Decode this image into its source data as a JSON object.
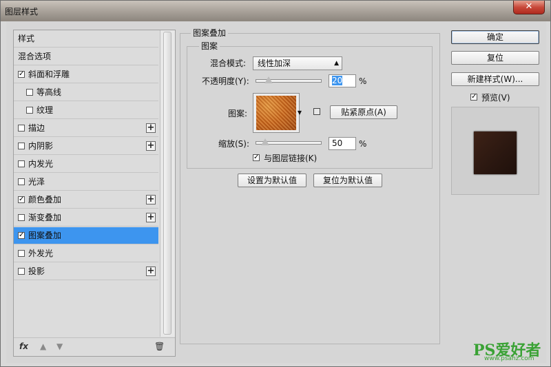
{
  "window": {
    "title": "图层样式",
    "close_glyph": "✕"
  },
  "style_list": {
    "items": [
      {
        "label": "样式",
        "checkbox": false,
        "checked": false,
        "indent": false,
        "plus": false,
        "selected": false
      },
      {
        "label": "混合选项",
        "checkbox": false,
        "checked": false,
        "indent": false,
        "plus": false,
        "selected": false
      },
      {
        "label": "斜面和浮雕",
        "checkbox": true,
        "checked": true,
        "indent": false,
        "plus": false,
        "selected": false
      },
      {
        "label": "等高线",
        "checkbox": true,
        "checked": false,
        "indent": true,
        "plus": false,
        "selected": false
      },
      {
        "label": "纹理",
        "checkbox": true,
        "checked": false,
        "indent": true,
        "plus": false,
        "selected": false
      },
      {
        "label": "描边",
        "checkbox": true,
        "checked": false,
        "indent": false,
        "plus": true,
        "selected": false
      },
      {
        "label": "内阴影",
        "checkbox": true,
        "checked": false,
        "indent": false,
        "plus": true,
        "selected": false
      },
      {
        "label": "内发光",
        "checkbox": true,
        "checked": false,
        "indent": false,
        "plus": false,
        "selected": false
      },
      {
        "label": "光泽",
        "checkbox": true,
        "checked": false,
        "indent": false,
        "plus": false,
        "selected": false
      },
      {
        "label": "颜色叠加",
        "checkbox": true,
        "checked": true,
        "indent": false,
        "plus": true,
        "selected": false
      },
      {
        "label": "渐变叠加",
        "checkbox": true,
        "checked": false,
        "indent": false,
        "plus": true,
        "selected": false
      },
      {
        "label": "图案叠加",
        "checkbox": true,
        "checked": true,
        "indent": false,
        "plus": false,
        "selected": true
      },
      {
        "label": "外发光",
        "checkbox": true,
        "checked": false,
        "indent": false,
        "plus": false,
        "selected": false
      },
      {
        "label": "投影",
        "checkbox": true,
        "checked": false,
        "indent": false,
        "plus": true,
        "selected": false
      }
    ],
    "plus_glyph": "+",
    "check_glyph": "✓",
    "bottom": {
      "fx": "fx",
      "up": "▲",
      "down": "▼",
      "trash": "🗑"
    }
  },
  "pattern_overlay": {
    "group_title": "图案叠加",
    "subgroup_title": "图案",
    "blend_mode_label": "混合模式:",
    "blend_mode_value": "线性加深",
    "opacity_label": "不透明度(Y):",
    "opacity_value": "20",
    "opacity_fraction": 0.2,
    "percent": "%",
    "pattern_label": "图案:",
    "snap_button": "贴紧原点(A)",
    "scale_label": "缩放(S):",
    "scale_value": "50",
    "scale_fraction": 0.5,
    "link_label": "与图层链接(K)",
    "link_checked": true,
    "make_default": "设置为默认值",
    "reset_default": "复位为默认值"
  },
  "right_panel": {
    "ok": "确定",
    "reset": "复位",
    "new_style": "新建样式(W)...",
    "preview_label": "预览(V)",
    "preview_checked": true
  },
  "watermark": {
    "main": "PS爱好者",
    "sub": "www.psahz.com"
  },
  "colors": {
    "selection": "#3d95ef",
    "panel": "#d6d6d6",
    "watermark": "#3aa235"
  }
}
